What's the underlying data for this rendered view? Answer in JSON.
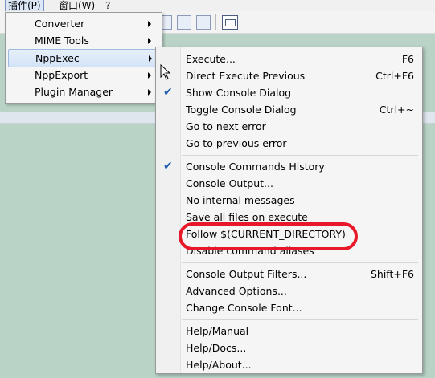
{
  "menubar": {
    "plugins": "插件(P)",
    "window": "窗口(W)",
    "help": "?"
  },
  "plugins_menu": [
    {
      "label": "Converter",
      "has_submenu": true
    },
    {
      "label": "MIME Tools",
      "has_submenu": true
    },
    {
      "label": "NppExec",
      "has_submenu": true,
      "highlighted": true
    },
    {
      "label": "NppExport",
      "has_submenu": true
    },
    {
      "label": "Plugin Manager",
      "has_submenu": true
    }
  ],
  "nppexec_menu": [
    {
      "label": "Execute...",
      "shortcut": "F6",
      "checked": false
    },
    {
      "label": "Direct Execute Previous",
      "shortcut": "Ctrl+F6",
      "checked": false
    },
    {
      "label": "Show Console Dialog",
      "shortcut": "",
      "checked": true
    },
    {
      "label": "Toggle Console Dialog",
      "shortcut": "Ctrl+~",
      "checked": false
    },
    {
      "label": "Go to next error",
      "shortcut": "",
      "checked": false
    },
    {
      "label": "Go to previous error",
      "shortcut": "",
      "checked": false
    },
    {
      "label": "Console Commands History",
      "shortcut": "",
      "checked": true
    },
    {
      "label": "Console Output...",
      "shortcut": "",
      "checked": false
    },
    {
      "label": "No internal messages",
      "shortcut": "",
      "checked": false
    },
    {
      "label": "Save all files on execute",
      "shortcut": "",
      "checked": false
    },
    {
      "label": "Follow $(CURRENT_DIRECTORY)",
      "shortcut": "",
      "checked": false,
      "annotated": true
    },
    {
      "label": "Disable command aliases",
      "shortcut": "",
      "checked": false
    },
    {
      "label": "Console Output Filters...",
      "shortcut": "Shift+F6",
      "checked": false
    },
    {
      "label": "Advanced Options...",
      "shortcut": "",
      "checked": false
    },
    {
      "label": "Change Console Font...",
      "shortcut": "",
      "checked": false
    },
    {
      "label": "Help/Manual",
      "shortcut": "",
      "checked": false
    },
    {
      "label": "Help/Docs...",
      "shortcut": "",
      "checked": false
    },
    {
      "label": "Help/About...",
      "shortcut": "",
      "checked": false
    }
  ],
  "check_glyph": "✔",
  "colors": {
    "annotation": "#e8182a",
    "check": "#1e5fb4",
    "highlight": "#d3e3f7",
    "background": "#b9d3c7"
  }
}
